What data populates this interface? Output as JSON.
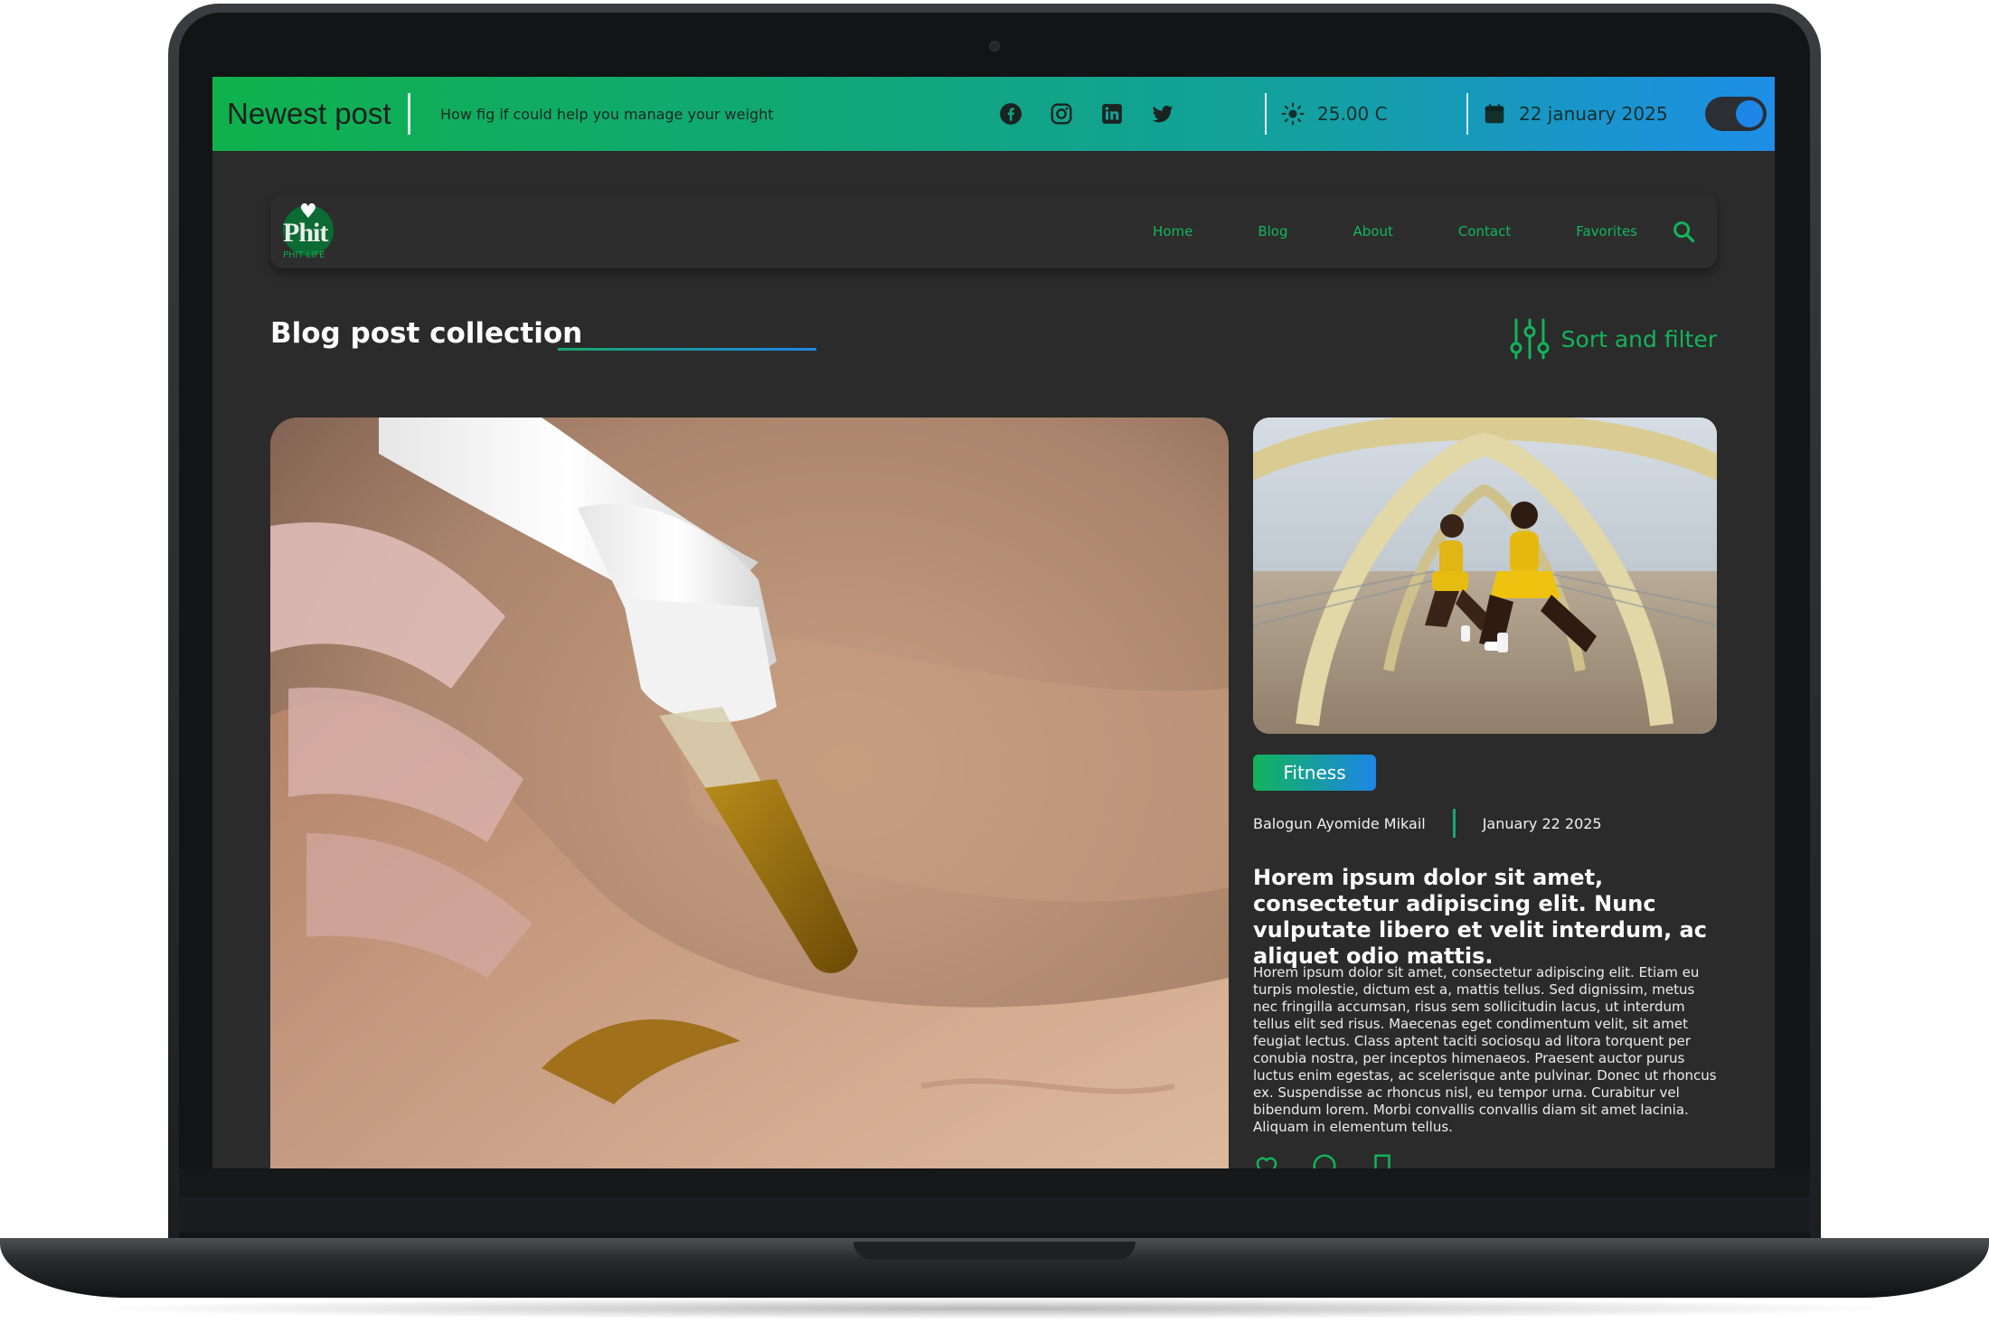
{
  "topbar": {
    "newest_label": "Newest post",
    "headline": "How fig if could help you manage your weight",
    "social_icons": [
      "facebook-icon",
      "instagram-icon",
      "linkedin-icon",
      "twitter-icon"
    ],
    "temperature": "25.00 C",
    "date": "22 january 2025",
    "toggle_on": true
  },
  "nav": {
    "logo_text": "Phit",
    "logo_subtext": "PHIT LIFE",
    "links": [
      "Home",
      "Blog",
      "About",
      "Contact",
      "Favorites"
    ]
  },
  "section": {
    "title": "Blog post collection",
    "sort_label": "Sort and filter"
  },
  "post": {
    "tag": "Fitness",
    "author": "Balogun Ayomide Mikail",
    "date": "January 22 2025",
    "title": "Horem ipsum dolor sit amet, consectetur adipiscing elit. Nunc vulputate libero et velit interdum, ac aliquet odio mattis.",
    "body": "Horem ipsum dolor sit amet, consectetur adipiscing elit. Etiam eu turpis molestie, dictum est a, mattis tellus. Sed dignissim, metus nec fringilla accumsan, risus sem sollicitudin lacus, ut interdum tellus elit sed risus. Maecenas eget condimentum velit, sit amet feugiat lectus. Class aptent taciti sociosqu ad litora torquent per conubia nostra, per inceptos himenaeos. Praesent auctor purus luctus enim egestas, ac scelerisque ante pulvinar. Donec ut rhoncus ex. Suspendisse ac rhoncus nisl, eu tempor urna. Curabitur vel bibendum lorem. Morbi convallis convallis diam sit amet lacinia. Aliquam in elementum tellus."
  },
  "colors": {
    "accent_green": "#12b35a",
    "accent_blue": "#1d86e6",
    "background": "#2b2b2b"
  }
}
